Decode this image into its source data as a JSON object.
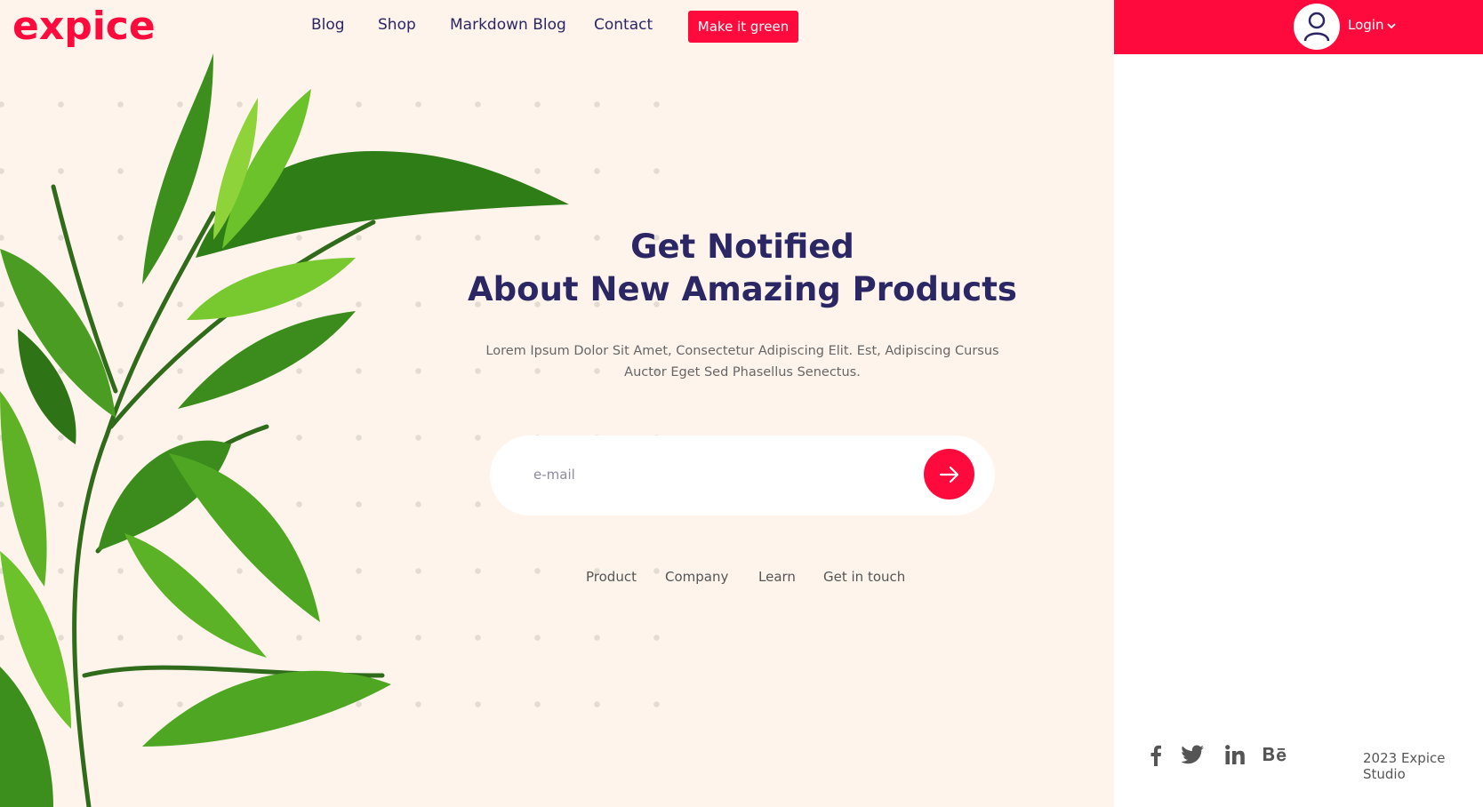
{
  "brand": {
    "logo_text": "expice",
    "accent_color": "#ff0a3c"
  },
  "nav": {
    "items": [
      {
        "label": "Blog"
      },
      {
        "label": "Shop"
      },
      {
        "label": "Markdown Blog"
      },
      {
        "label": "Contact"
      }
    ],
    "cta_label": "Make it green"
  },
  "user": {
    "login_label": "Login",
    "avatar_icon": "user-icon",
    "dropdown_icon": "chevron-down-icon"
  },
  "hero": {
    "title_line1": "Get Notified",
    "title_line2": "About New Amazing Products",
    "description_line1": "Lorem Ipsum Dolor Sit Amet, Consectetur Adipiscing Elit. Est, Adipiscing Cursus",
    "description_line2": "Auctor Eget Sed Phasellus Senectus."
  },
  "subscribe": {
    "placeholder": "e-mail",
    "value": "",
    "submit_icon": "arrow-right-icon"
  },
  "footer": {
    "links": [
      {
        "label": "Product"
      },
      {
        "label": "Company"
      },
      {
        "label": "Learn"
      },
      {
        "label": "Get in touch"
      }
    ],
    "social": [
      "facebook-icon",
      "twitter-icon",
      "linkedin-icon",
      "behance-icon"
    ],
    "copyright": "2023 Expice Studio"
  }
}
